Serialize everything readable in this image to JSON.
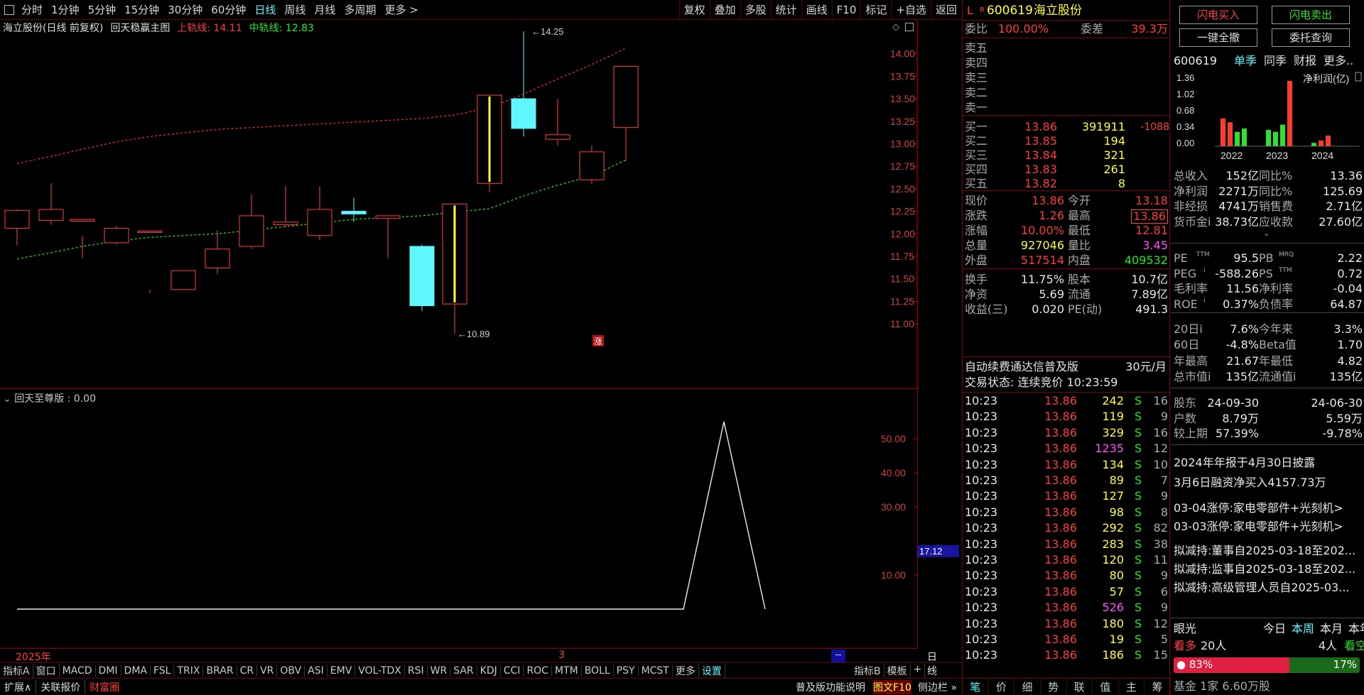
{
  "toolbar": {
    "periods": [
      "分时",
      "1分钟",
      "5分钟",
      "15分钟",
      "30分钟",
      "60分钟",
      "日线",
      "周线",
      "月线",
      "多周期",
      "更多 >"
    ],
    "active_period": "日线",
    "right": [
      "复权",
      "叠加",
      "多股",
      "统计",
      "画线",
      "F10",
      "标记",
      "+自选",
      "返回"
    ]
  },
  "chart_info": {
    "name": "海立股份(日线 前复权)",
    "indicator": "回天稳赢主图",
    "upper_label": "上轨线:",
    "upper_value": "14.11",
    "mid_label": "中轨线:",
    "mid_value": "12.83"
  },
  "price_axis": [
    "14.00",
    "13.75",
    "13.50",
    "13.25",
    "13.00",
    "12.75",
    "12.50",
    "12.25",
    "12.00",
    "11.75",
    "11.50",
    "11.25",
    "11.00"
  ],
  "annotations": {
    "high": "14.25",
    "low": "10.89",
    "limit_up": "涨"
  },
  "sub_info": "回天至尊版 : 0.00",
  "sub_axis": [
    "50.00",
    "40.00",
    "30.00",
    "10.00"
  ],
  "sub_marker": "17.12",
  "x_labels": {
    "year": "2025年",
    "month": "3",
    "period": "日线",
    "more": "--"
  },
  "chart_data": [
    {
      "type": "candlestick",
      "x": [
        "c1",
        "c2",
        "c3",
        "c4",
        "c5",
        "c6",
        "c7",
        "c8",
        "c9",
        "c10",
        "c11",
        "c12",
        "c13",
        "c14",
        "c15",
        "c16",
        "c17",
        "c18",
        "c19"
      ],
      "ohlc": [
        [
          12.06,
          12.26,
          11.87,
          12.27
        ],
        [
          12.15,
          12.27,
          12.1,
          12.56
        ],
        [
          12.14,
          12.16,
          11.73,
          11.98
        ],
        [
          11.9,
          12.06,
          11.88,
          12.09
        ],
        [
          12.03,
          12.03,
          11.34,
          11.38
        ],
        [
          11.38,
          11.59,
          11.38,
          11.59
        ],
        [
          11.62,
          11.83,
          11.55,
          12.04
        ],
        [
          11.86,
          12.2,
          11.83,
          12.44
        ],
        [
          12.1,
          12.13,
          12.07,
          12.53
        ],
        [
          11.98,
          12.27,
          11.93,
          12.53
        ],
        [
          12.25,
          12.22,
          12.13,
          12.4
        ],
        [
          12.17,
          12.2,
          11.73,
          12.2
        ],
        [
          11.86,
          11.2,
          11.14,
          11.88
        ],
        [
          11.22,
          12.33,
          10.89,
          12.33
        ],
        [
          12.56,
          13.54,
          12.46,
          13.54
        ],
        [
          13.5,
          13.17,
          13.08,
          14.25
        ],
        [
          13.05,
          13.1,
          12.98,
          13.5
        ],
        [
          12.6,
          12.91,
          12.55,
          12.98
        ],
        [
          13.18,
          13.86,
          12.81,
          13.86
        ]
      ],
      "upper_line": "上轨线",
      "middle_line": "中轨线"
    },
    {
      "type": "line",
      "name": "回天至尊版",
      "peak": 55.0
    }
  ],
  "bottom_tabs": [
    "指标A",
    "窗口",
    "MACD",
    "DMI",
    "DMA",
    "FSL",
    "TRIX",
    "BRAR",
    "CR",
    "VR",
    "OBV",
    "ASI",
    "EMV",
    "VOL-TDX",
    "RSI",
    "WR",
    "SAR",
    "KDJ",
    "CCI",
    "ROC",
    "MTM",
    "BOLL",
    "PSY",
    "MCST",
    "更多",
    "设置"
  ],
  "bottom_tabs_right": [
    "指标B",
    "模板",
    "+",
    "-"
  ],
  "status_bar": {
    "expand": "扩展∧",
    "related": "关联报价",
    "wealth": "财富圈",
    "func": "普及版功能说明",
    "f10": "图文F10",
    "sidebar": "侧边栏 »"
  },
  "quote": {
    "flag": "L",
    "flag2": "R",
    "code": "600619",
    "name": "海立股份",
    "webi_label": "委比",
    "webi": "100.00%",
    "weicha_label": "委差",
    "weicha": "39.3万",
    "asks": [
      "卖五",
      "卖四",
      "卖三",
      "卖二",
      "卖一"
    ],
    "bids": [
      {
        "l": "买一",
        "p": "13.86",
        "v": "391911",
        "c": "-1088"
      },
      {
        "l": "买二",
        "p": "13.85",
        "v": "194",
        "c": ""
      },
      {
        "l": "买三",
        "p": "13.84",
        "v": "321",
        "c": ""
      },
      {
        "l": "买四",
        "p": "13.83",
        "v": "261",
        "c": ""
      },
      {
        "l": "买五",
        "p": "13.82",
        "v": "8",
        "c": ""
      }
    ],
    "stats": [
      {
        "l1": "现价",
        "v1": "13.86",
        "l2": "今开",
        "v2": "13.18"
      },
      {
        "l1": "涨跌",
        "v1": "1.26",
        "l2": "最高",
        "v2": "13.86"
      },
      {
        "l1": "涨幅",
        "v1": "10.00%",
        "l2": "最低",
        "v2": "12.81"
      },
      {
        "l1": "总量",
        "v1": "927046",
        "l2": "量比",
        "v2": "3.45"
      },
      {
        "l1": "外盘",
        "v1": "517514",
        "l2": "内盘",
        "v2": "409532"
      },
      {
        "l1": "换手",
        "v1": "11.75%",
        "l2": "股本",
        "v2": "10.7亿"
      },
      {
        "l1": "净资",
        "v1": "5.69",
        "l2": "流通",
        "v2": "7.89亿"
      },
      {
        "l1": "收益(三)",
        "v1": "0.020",
        "l2": "PE(动)",
        "v2": "491.3"
      }
    ],
    "fee": "自动续费通达信普及版",
    "fee_price": "30元/月",
    "trade_status": "交易状态: 连续竞价 10:23:59",
    "ticks": [
      {
        "t": "10:23",
        "p": "13.86",
        "v": "242",
        "s": "S",
        "n": "16"
      },
      {
        "t": "10:23",
        "p": "13.86",
        "v": "119",
        "s": "S",
        "n": "9"
      },
      {
        "t": "10:23",
        "p": "13.86",
        "v": "329",
        "s": "S",
        "n": "16"
      },
      {
        "t": "10:23",
        "p": "13.86",
        "v": "1235",
        "s": "S",
        "n": "12"
      },
      {
        "t": "10:23",
        "p": "13.86",
        "v": "134",
        "s": "S",
        "n": "10"
      },
      {
        "t": "10:23",
        "p": "13.86",
        "v": "89",
        "s": "S",
        "n": "7"
      },
      {
        "t": "10:23",
        "p": "13.86",
        "v": "127",
        "s": "S",
        "n": "9"
      },
      {
        "t": "10:23",
        "p": "13.86",
        "v": "98",
        "s": "S",
        "n": "8"
      },
      {
        "t": "10:23",
        "p": "13.86",
        "v": "292",
        "s": "S",
        "n": "82"
      },
      {
        "t": "10:23",
        "p": "13.86",
        "v": "283",
        "s": "S",
        "n": "38"
      },
      {
        "t": "10:23",
        "p": "13.86",
        "v": "120",
        "s": "S",
        "n": "11"
      },
      {
        "t": "10:23",
        "p": "13.86",
        "v": "80",
        "s": "S",
        "n": "9"
      },
      {
        "t": "10:23",
        "p": "13.86",
        "v": "57",
        "s": "S",
        "n": "6"
      },
      {
        "t": "10:23",
        "p": "13.86",
        "v": "526",
        "s": "S",
        "n": "9"
      },
      {
        "t": "10:23",
        "p": "13.86",
        "v": "180",
        "s": "S",
        "n": "12"
      },
      {
        "t": "10:23",
        "p": "13.86",
        "v": "19",
        "s": "S",
        "n": "5"
      },
      {
        "t": "10:23",
        "p": "13.86",
        "v": "186",
        "s": "S",
        "n": "15"
      }
    ],
    "bottom_tabs": [
      "笔",
      "价",
      "细",
      "势",
      "联",
      "值",
      "主",
      "筹"
    ]
  },
  "side": {
    "buy_btn": "闪电买入",
    "sell_btn": "闪电卖出",
    "cancel_btn": "一键全撤",
    "query_btn": "委托查询",
    "code": "600619",
    "tabs": [
      "单季",
      "同季",
      "财报",
      "更多.."
    ],
    "fin_chart": {
      "title": "净利润(亿)",
      "yticks": [
        "1.36",
        "1.02",
        "0.68",
        "0.34",
        "0.00"
      ],
      "years": [
        "2022",
        "2023",
        "2024"
      ]
    },
    "fin": [
      {
        "l1": "总收入",
        "v1": "152亿",
        "l2": "同比%",
        "v2": "13.36"
      },
      {
        "l1": "净利润",
        "v1": "2271万",
        "l2": "同比%",
        "v2": "125.69"
      },
      {
        "l1": "非经损",
        "v1": "4741万",
        "l2": "销售费",
        "v2": "2.71亿"
      },
      {
        "l1": "货币金i",
        "v1": "38.73亿",
        "l2": "应收款",
        "v2": "27.60亿"
      }
    ],
    "val": [
      {
        "l1": "PE",
        "s1": "TTM",
        "v1": "95.5",
        "l2": "PB",
        "s2": "MRQ",
        "v2": "2.22"
      },
      {
        "l1": "PEG",
        "s1": "i",
        "v1": "-588.26",
        "l2": "PS",
        "s2": "TTM",
        "v2": "0.72"
      },
      {
        "l1": "毛利率",
        "s1": "",
        "v1": "11.56",
        "l2": "净利率",
        "s2": "",
        "v2": "-0.04"
      },
      {
        "l1": "ROE",
        "s1": "i",
        "v1": "0.37%",
        "l2": "负债率",
        "s2": "",
        "v2": "64.87"
      }
    ],
    "perf": [
      {
        "l1": "20日i",
        "v1": "7.6%",
        "l2": "今年来",
        "v2": "3.3%"
      },
      {
        "l1": "60日",
        "v1": "-4.8%",
        "l2": "Beta值",
        "v2": "1.70"
      },
      {
        "l1": "年最高",
        "v1": "21.67",
        "l2": "年最低",
        "v2": "4.82"
      },
      {
        "l1": "总市值i",
        "v1": "135亿",
        "l2": "流通值i",
        "v2": "135亿"
      }
    ],
    "holders": [
      {
        "l": "股东",
        "a": "24-09-30",
        "b": "24-06-30"
      },
      {
        "l": "户数",
        "a": "8.79万",
        "b": "5.59万"
      },
      {
        "l": "较上期",
        "a": "57.39%",
        "b": "-9.78%"
      }
    ],
    "notes": [
      "2024年年报于4月30日披露",
      "3月6日融资净买入4157.73万",
      "03-04涨停:家电零部件+光刻机>",
      "03-03涨停:家电零部件+光刻机>",
      "拟减持:董事自2025-03-18至202...",
      "拟减持:监事自2025-03-18至202...",
      "拟减持:高级管理人员自2025-03..."
    ],
    "eye": {
      "label": "眼光",
      "today": "今日",
      "week": "本周",
      "month": "本月",
      "year": "本年",
      "bull": "看多",
      "bull_n": "20人",
      "bear_n": "4人",
      "bear": "看空",
      "bull_pct": "83%",
      "bear_pct": "17%",
      "bull_frac": 0.83,
      "bottom": "基金 1家 6.60万股"
    }
  }
}
